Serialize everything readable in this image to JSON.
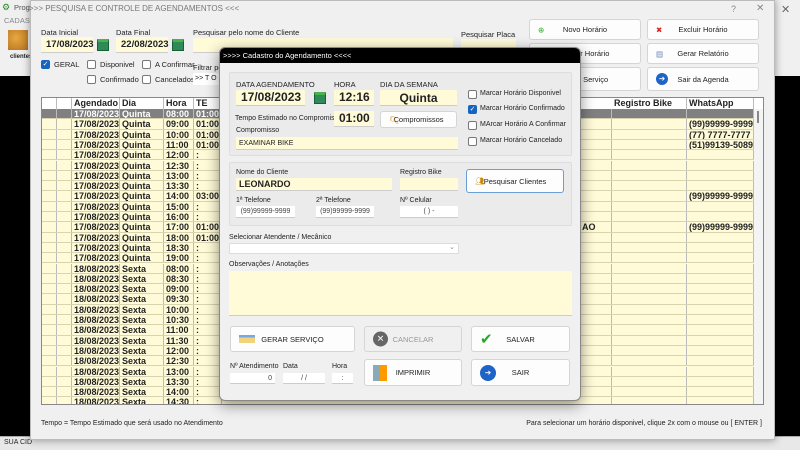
{
  "background_app": {
    "title": "Prog",
    "menu": "CADAS",
    "clientes_label": "clientes",
    "status": "SUA CID"
  },
  "window": {
    "title": ">>> PESQUISA E CONTROLE DE AGENDAMENTOS <<<",
    "help": "?",
    "close": "✕",
    "outer_close": "✕"
  },
  "filters": {
    "data_inicial_label": "Data Inicial",
    "data_inicial": "17/08/2023",
    "data_final_label": "Data Final",
    "data_final": "22/08/2023",
    "pesquisar_nome_label": "Pesquisar pelo nome do Cliente",
    "pesquisar_nome": "",
    "pesquisar_placa_label": "Pesquisar Placa",
    "pesquisar_placa": "",
    "filtrar_label": "Filtrar por",
    "filtrar_value": ">> T O",
    "checks": [
      {
        "label": "GERAL",
        "checked": true
      },
      {
        "label": "Disponivel",
        "checked": false
      },
      {
        "label": "A Confirmar",
        "checked": false
      },
      {
        "label": "Confirmado",
        "checked": false
      },
      {
        "label": "Cancelados",
        "checked": false
      }
    ]
  },
  "actions": {
    "novo": "Novo Horário",
    "excluir": "Excluir Horário",
    "alterar": "Alterar Horário",
    "relatorio": "Gerar Relatório",
    "servico": "Gerar  Serviço",
    "sair": "Sair da Agenda"
  },
  "grid": {
    "headers": {
      "agendado": "Agendado",
      "dia": "Dia",
      "hora": "Hora",
      "te": "TE",
      "registro": "Registro Bike",
      "whatsapp": "WhatsApp"
    },
    "rows": [
      [
        "17/08/2023",
        "Quinta",
        "08:00",
        "01:00",
        "",
        ""
      ],
      [
        "17/08/2023",
        "Quinta",
        "09:00",
        "01:00",
        "",
        "(99)99999-9999"
      ],
      [
        "17/08/2023",
        "Quinta",
        "10:00",
        "01:00",
        "",
        "(77) 7777-7777"
      ],
      [
        "17/08/2023",
        "Quinta",
        "11:00",
        "01:00",
        "",
        "(51)99139-5089"
      ],
      [
        "17/08/2023",
        "Quinta",
        "12:00",
        ":",
        "",
        ""
      ],
      [
        "17/08/2023",
        "Quinta",
        "12:30",
        ":",
        "",
        ""
      ],
      [
        "17/08/2023",
        "Quinta",
        "13:00",
        ":",
        "",
        ""
      ],
      [
        "17/08/2023",
        "Quinta",
        "13:30",
        ":",
        "",
        ""
      ],
      [
        "17/08/2023",
        "Quinta",
        "14:00",
        "03:00",
        "",
        "(99)99999-9999"
      ],
      [
        "17/08/2023",
        "Quinta",
        "15:00",
        ":",
        "",
        ""
      ],
      [
        "17/08/2023",
        "Quinta",
        "16:00",
        ":",
        "",
        ""
      ],
      [
        "17/08/2023",
        "Quinta",
        "17:00",
        "01:00",
        "AO",
        "(99)99999-9999"
      ],
      [
        "17/08/2023",
        "Quinta",
        "18:00",
        "01:00",
        "",
        ""
      ],
      [
        "17/08/2023",
        "Quinta",
        "18:30",
        ":",
        "",
        ""
      ],
      [
        "17/08/2023",
        "Quinta",
        "19:00",
        ":",
        "",
        ""
      ],
      [
        "18/08/2023",
        "Sexta",
        "08:00",
        ":",
        "",
        ""
      ],
      [
        "18/08/2023",
        "Sexta",
        "08:30",
        ":",
        "",
        ""
      ],
      [
        "18/08/2023",
        "Sexta",
        "09:00",
        ":",
        "",
        ""
      ],
      [
        "18/08/2023",
        "Sexta",
        "09:30",
        ":",
        "",
        ""
      ],
      [
        "18/08/2023",
        "Sexta",
        "10:00",
        ":",
        "",
        ""
      ],
      [
        "18/08/2023",
        "Sexta",
        "10:30",
        ":",
        "",
        ""
      ],
      [
        "18/08/2023",
        "Sexta",
        "11:00",
        ":",
        "",
        ""
      ],
      [
        "18/08/2023",
        "Sexta",
        "11:30",
        ":",
        "",
        ""
      ],
      [
        "18/08/2023",
        "Sexta",
        "12:00",
        ":",
        "",
        ""
      ],
      [
        "18/08/2023",
        "Sexta",
        "12:30",
        ":",
        "",
        ""
      ],
      [
        "18/08/2023",
        "Sexta",
        "13:00",
        ":",
        "",
        ""
      ],
      [
        "18/08/2023",
        "Sexta",
        "13:30",
        ":",
        "",
        ""
      ],
      [
        "18/08/2023",
        "Sexta",
        "14:00",
        ":",
        "",
        ""
      ],
      [
        "18/08/2023",
        "Sexta",
        "14:30",
        ":",
        "",
        ""
      ]
    ]
  },
  "footer": {
    "left": "Tempo = Tempo Estimado que será usado no Atendimento",
    "right": "Para selecionar um horário disponivel, clique 2x com o mouse ou [ ENTER ]"
  },
  "dialog": {
    "title": ">>>>  Cadastro do Agendamento  <<<<",
    "data_label": "DATA AGENDAMENTO",
    "data": "17/08/2023",
    "hora_label": "HORA",
    "hora": "12:16",
    "dia_label": "DIA DA SEMANA",
    "dia": "Quinta",
    "tempo_label": "Tempo Estimado no Compromisso",
    "tempo": "01:00",
    "compromissos_btn": "Compromissos",
    "compromisso_label": "Compromisso",
    "compromisso": "EXAMINAR BIKE",
    "status": [
      {
        "label": "Marcar Horário Disponivel",
        "checked": false
      },
      {
        "label": "Marcar Horário Confirmado",
        "checked": true
      },
      {
        "label": "MArcar Horário A Confirmar",
        "checked": false
      },
      {
        "label": "Marcar Horário Cancelado",
        "checked": false
      }
    ],
    "nome_label": "Nome do Cliente",
    "nome": "LEONARDO",
    "registro_label": "Registro Bike",
    "registro": "",
    "pesquisar_clientes": "Pesquisar Clientes",
    "tel1_label": "1ª Telefone",
    "tel1": "(99)99999-9999",
    "tel2_label": "2ª Telefone",
    "tel2": "(99)99999-9999",
    "cel_label": "Nº Celular",
    "cel": "(  )    -",
    "atendente_label": "Selecionar Atendente / Mecânico",
    "atendente": "",
    "obs_label": "Observações  / Anotações",
    "obs": "",
    "gerar_servico": "GERAR  SERVIÇO",
    "cancelar": "CANCELAR",
    "salvar": "SALVAR",
    "imprimir": "IMPRIMIR",
    "sair": "SAIR",
    "atendimento_label": "Nº Atendimento",
    "atendimento": "0",
    "data2_label": "Data",
    "data2": " /  /",
    "hora2_label": "Hora",
    "hora2": ":"
  }
}
